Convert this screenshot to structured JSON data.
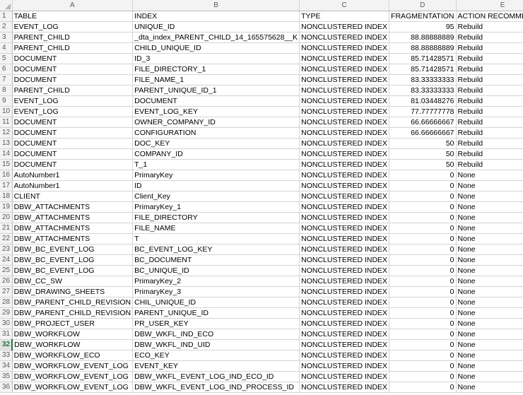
{
  "columns": [
    "A",
    "B",
    "C",
    "D",
    "E"
  ],
  "active_row": "32",
  "rows": [
    {
      "n": "1",
      "a": "TABLE",
      "b": "INDEX",
      "c": "TYPE",
      "d": "FRAGMENTATION",
      "e": "ACTION RECOMMENDED"
    },
    {
      "n": "2",
      "a": "EVENT_LOG",
      "b": "UNIQUE_ID",
      "c": "NONCLUSTERED INDEX",
      "d": "95",
      "e": "Rebuild"
    },
    {
      "n": "3",
      "a": "PARENT_CHILD",
      "b": "_dta_index_PARENT_CHILD_14_165575628__K",
      "c": "NONCLUSTERED INDEX",
      "d": "88.88888889",
      "e": "Rebuild"
    },
    {
      "n": "4",
      "a": "PARENT_CHILD",
      "b": "CHILD_UNIQUE_ID",
      "c": "NONCLUSTERED INDEX",
      "d": "88.88888889",
      "e": "Rebuild"
    },
    {
      "n": "5",
      "a": "DOCUMENT",
      "b": "ID_3",
      "c": "NONCLUSTERED INDEX",
      "d": "85.71428571",
      "e": "Rebuild"
    },
    {
      "n": "6",
      "a": "DOCUMENT",
      "b": "FILE_DIRECTORY_1",
      "c": "NONCLUSTERED INDEX",
      "d": "85.71428571",
      "e": "Rebuild"
    },
    {
      "n": "7",
      "a": "DOCUMENT",
      "b": "FILE_NAME_1",
      "c": "NONCLUSTERED INDEX",
      "d": "83.33333333",
      "e": "Rebuild"
    },
    {
      "n": "8",
      "a": "PARENT_CHILD",
      "b": "PARENT_UNIQUE_ID_1",
      "c": "NONCLUSTERED INDEX",
      "d": "83.33333333",
      "e": "Rebuild"
    },
    {
      "n": "9",
      "a": "EVENT_LOG",
      "b": "DOCUMENT",
      "c": "NONCLUSTERED INDEX",
      "d": "81.03448276",
      "e": "Rebuild"
    },
    {
      "n": "10",
      "a": "EVENT_LOG",
      "b": "EVENT_LOG_KEY",
      "c": "NONCLUSTERED INDEX",
      "d": "77.77777778",
      "e": "Rebuild"
    },
    {
      "n": "11",
      "a": "DOCUMENT",
      "b": "OWNER_COMPANY_ID",
      "c": "NONCLUSTERED INDEX",
      "d": "66.66666667",
      "e": "Rebuild"
    },
    {
      "n": "12",
      "a": "DOCUMENT",
      "b": "CONFIGURATION",
      "c": "NONCLUSTERED INDEX",
      "d": "66.66666667",
      "e": "Rebuild"
    },
    {
      "n": "13",
      "a": "DOCUMENT",
      "b": "DOC_KEY",
      "c": "NONCLUSTERED INDEX",
      "d": "50",
      "e": "Rebuild"
    },
    {
      "n": "14",
      "a": "DOCUMENT",
      "b": "COMPANY_ID",
      "c": "NONCLUSTERED INDEX",
      "d": "50",
      "e": "Rebuild"
    },
    {
      "n": "15",
      "a": "DOCUMENT",
      "b": "T_1",
      "c": "NONCLUSTERED INDEX",
      "d": "50",
      "e": "Rebuild"
    },
    {
      "n": "16",
      "a": "AutoNumber1",
      "b": "PrimaryKey",
      "c": "NONCLUSTERED INDEX",
      "d": "0",
      "e": "None"
    },
    {
      "n": "17",
      "a": "AutoNumber1",
      "b": "ID",
      "c": "NONCLUSTERED INDEX",
      "d": "0",
      "e": "None"
    },
    {
      "n": "18",
      "a": "CLIENT",
      "b": "Client_Key",
      "c": "NONCLUSTERED INDEX",
      "d": "0",
      "e": "None"
    },
    {
      "n": "19",
      "a": "DBW_ATTACHMENTS",
      "b": "PrimaryKey_1",
      "c": "NONCLUSTERED INDEX",
      "d": "0",
      "e": "None"
    },
    {
      "n": "20",
      "a": "DBW_ATTACHMENTS",
      "b": "FILE_DIRECTORY",
      "c": "NONCLUSTERED INDEX",
      "d": "0",
      "e": "None"
    },
    {
      "n": "21",
      "a": "DBW_ATTACHMENTS",
      "b": "FILE_NAME",
      "c": "NONCLUSTERED INDEX",
      "d": "0",
      "e": "None"
    },
    {
      "n": "22",
      "a": "DBW_ATTACHMENTS",
      "b": "T",
      "c": "NONCLUSTERED INDEX",
      "d": "0",
      "e": "None"
    },
    {
      "n": "23",
      "a": "DBW_BC_EVENT_LOG",
      "b": "BC_EVENT_LOG_KEY",
      "c": "NONCLUSTERED INDEX",
      "d": "0",
      "e": "None"
    },
    {
      "n": "24",
      "a": "DBW_BC_EVENT_LOG",
      "b": "BC_DOCUMENT",
      "c": "NONCLUSTERED INDEX",
      "d": "0",
      "e": "None"
    },
    {
      "n": "25",
      "a": "DBW_BC_EVENT_LOG",
      "b": "BC_UNIQUE_ID",
      "c": "NONCLUSTERED INDEX",
      "d": "0",
      "e": "None"
    },
    {
      "n": "26",
      "a": "DBW_CC_SW",
      "b": "PrimaryKey_2",
      "c": "NONCLUSTERED INDEX",
      "d": "0",
      "e": "None"
    },
    {
      "n": "27",
      "a": "DBW_DRAWING_SHEETS",
      "b": "PrimaryKey_3",
      "c": "NONCLUSTERED INDEX",
      "d": "0",
      "e": "None"
    },
    {
      "n": "28",
      "a": "DBW_PARENT_CHILD_REVISION",
      "b": "CHIL_UNIQUE_ID",
      "c": "NONCLUSTERED INDEX",
      "d": "0",
      "e": "None"
    },
    {
      "n": "29",
      "a": "DBW_PARENT_CHILD_REVISION",
      "b": "PARENT_UNIQUE_ID",
      "c": "NONCLUSTERED INDEX",
      "d": "0",
      "e": "None"
    },
    {
      "n": "30",
      "a": "DBW_PROJECT_USER",
      "b": "PR_USER_KEY",
      "c": "NONCLUSTERED INDEX",
      "d": "0",
      "e": "None"
    },
    {
      "n": "31",
      "a": "DBW_WORKFLOW",
      "b": "DBW_WKFL_IND_ECO",
      "c": "NONCLUSTERED INDEX",
      "d": "0",
      "e": "None"
    },
    {
      "n": "32",
      "a": "DBW_WORKFLOW",
      "b": "DBW_WKFL_IND_UID",
      "c": "NONCLUSTERED INDEX",
      "d": "0",
      "e": "None"
    },
    {
      "n": "33",
      "a": "DBW_WORKFLOW_ECO",
      "b": "ECO_KEY",
      "c": "NONCLUSTERED INDEX",
      "d": "0",
      "e": "None"
    },
    {
      "n": "34",
      "a": "DBW_WORKFLOW_EVENT_LOG",
      "b": "EVENT_KEY",
      "c": "NONCLUSTERED INDEX",
      "d": "0",
      "e": "None"
    },
    {
      "n": "35",
      "a": "DBW_WORKFLOW_EVENT_LOG",
      "b": "DBW_WKFL_EVENT_LOG_IND_ECO_ID",
      "c": "NONCLUSTERED INDEX",
      "d": "0",
      "e": "None"
    },
    {
      "n": "36",
      "a": "DBW_WORKFLOW_EVENT_LOG",
      "b": "DBW_WKFL_EVENT_LOG_IND_PROCESS_ID",
      "c": "NONCLUSTERED INDEX",
      "d": "0",
      "e": "None"
    }
  ]
}
